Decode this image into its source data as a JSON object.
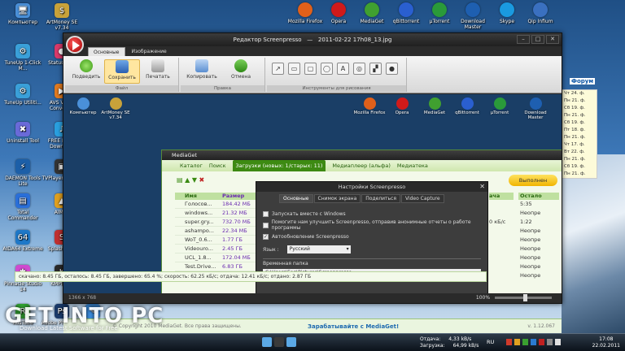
{
  "desktop": {
    "icons": [
      {
        "label": "Компьютер",
        "color": "#4a90d9",
        "glyph": "🖥"
      },
      {
        "label": "ArtMoney SE v7.34",
        "color": "#c8a23a",
        "glyph": "$"
      },
      {
        "label": "TuneUp 1-Click M...",
        "color": "#3aa0d9",
        "glyph": "⚙"
      },
      {
        "label": "StatusMa...",
        "color": "#d93a6a",
        "glyph": "●"
      },
      {
        "label": "TuneUp Utiliti...",
        "color": "#3aa0d9",
        "glyph": "⚙"
      },
      {
        "label": "AVS Video Converter",
        "color": "#e07a20",
        "glyph": "▶"
      },
      {
        "label": "Uninstall Tool",
        "color": "#6a6ad9",
        "glyph": "✖"
      },
      {
        "label": "FREE Music Download",
        "color": "#2aa0e0",
        "glyph": "♪"
      },
      {
        "label": "DAEMON Tools Lite",
        "color": "#1c5fa8",
        "glyph": "⚡"
      },
      {
        "label": "TVPlayer Classic",
        "color": "#333333",
        "glyph": "▣"
      },
      {
        "label": "Total Commander",
        "color": "#2a6fd9",
        "glyph": "▤"
      },
      {
        "label": "AIMP2",
        "color": "#e0a020",
        "glyph": "▲"
      },
      {
        "label": "AIDA64 Extreme",
        "color": "#1e78c8",
        "glyph": "64"
      },
      {
        "label": "Splash PRO",
        "color": "#c03030",
        "glyph": "S"
      },
      {
        "label": "Pinnacle Studio 14",
        "color": "#d04ad0",
        "glyph": "✱"
      },
      {
        "label": "KMPlayer",
        "color": "#2a2a2a",
        "glyph": "K"
      },
      {
        "label": "RusTube",
        "color": "#30a030",
        "glyph": "R"
      },
      {
        "label": "Adobe Photosh...",
        "color": "#1a3a6a",
        "glyph": "Ps"
      },
      {
        "label": "Paint",
        "color": "#3a8ad9",
        "glyph": "✎"
      }
    ],
    "top_icons": [
      {
        "label": "Mozilla Firefox",
        "color": "#e0601a"
      },
      {
        "label": "Opera",
        "color": "#d01a1a"
      },
      {
        "label": "MediaGet",
        "color": "#40a030"
      },
      {
        "label": "qBittorrent",
        "color": "#2a5fd0"
      },
      {
        "label": "µTorrent",
        "color": "#2a9a3a"
      },
      {
        "label": "Download Master",
        "color": "#1e5fb0"
      },
      {
        "label": "Skype",
        "color": "#1a9ae0"
      },
      {
        "label": "Qip Infium",
        "color": "#3a70c0"
      }
    ]
  },
  "editor": {
    "title": "Редактор Screenpresso",
    "filename": "2011-02-22 17h08_13.jpg",
    "tabs": [
      "Основные",
      "Изображение"
    ],
    "groups": {
      "file": {
        "label": "Файл",
        "buttons": [
          "Подведить",
          "Сохранить",
          "Печатать"
        ]
      },
      "edit": {
        "label": "Правка",
        "buttons": [
          "Копировать",
          "Отмена"
        ]
      },
      "draw": {
        "label": "Инструменты для рисования"
      }
    },
    "status_size": "1366 x 768",
    "zoom_label": "100%",
    "zoom_fraction": 0.5
  },
  "inner_icons": [
    {
      "label": "Компьютер",
      "color": "#4a90d9"
    },
    {
      "label": "ArtMoney SE v7.34",
      "color": "#c8a23a"
    },
    {
      "label": "Mozilla Firefox",
      "color": "#e0601a"
    },
    {
      "label": "Opera",
      "color": "#d01a1a"
    },
    {
      "label": "MediaGet",
      "color": "#40a030"
    },
    {
      "label": "qBittorrent",
      "color": "#2a5fd0"
    },
    {
      "label": "µTorrent",
      "color": "#2a9a3a"
    },
    {
      "label": "Download Master",
      "color": "#1e5fb0"
    }
  ],
  "mediaget": {
    "title": "MediaGet",
    "menu": [
      "Каталог",
      "Поиск",
      "Загрузки (новых: 1/старых: 11)",
      "Медиаплеер (альфа)",
      "Медиатека"
    ],
    "done_button": "Выполнен",
    "columns": {
      "name": "Имя",
      "size": "Размер",
      "speed": "ача",
      "remain": "Остало"
    },
    "rows": [
      {
        "name": "Голосов...",
        "size": "184.42 МБ",
        "speed": "",
        "remain": "5:35"
      },
      {
        "name": "windows...",
        "size": "21.32 МБ",
        "speed": "",
        "remain": "Неопре"
      },
      {
        "name": "super.gry...",
        "size": "732.70 МБ",
        "speed": "0 кБ/с",
        "remain": "1:22"
      },
      {
        "name": "ashampo...",
        "size": "22.34 МБ",
        "speed": "",
        "remain": "Неопре"
      },
      {
        "name": "WoT_0.6...",
        "size": "1.77 ГБ",
        "speed": "",
        "remain": "Неопре"
      },
      {
        "name": "Videouro...",
        "size": "2.45 ГБ",
        "speed": "",
        "remain": "Неопре"
      },
      {
        "name": "UCL_1.8...",
        "size": "172.04 МБ",
        "speed": "",
        "remain": "Неопре"
      },
      {
        "name": "Test.Drive...",
        "size": "6.83 ГБ",
        "speed": "",
        "remain": "Неопре"
      },
      {
        "name": "Screenpr...",
        "size": "6.04 МБ",
        "speed": "",
        "remain": "Неопре"
      }
    ],
    "statusline": "скачано: 8.45 ГБ, осталось: 8.45 ГБ, завершено: 65.4 %; скорость: 62.25 кБ/с; отдача: 12.41 кБ/с; отдано: 2.87 ГБ"
  },
  "settings": {
    "title": "Настройки Screenpresso",
    "tabs": [
      "Основные",
      "Снимок экрана",
      "Поделиться",
      "Video Capture"
    ],
    "options": [
      {
        "label": "Запускать вместе с Windows",
        "checked": ""
      },
      {
        "label": "Помогите нам улучшить Screenpresso, отправив анонимные отчеты о работе программы",
        "checked": ""
      },
      {
        "label": "Автообновление Screenpresso",
        "checked": "✓"
      }
    ],
    "lang_label": "Язык :",
    "lang_value": "Русский",
    "temp_label": "Временная папка",
    "temp_path": "C:\\Users\\Гоя\\Pictures\\Screenpresso"
  },
  "right_panel": {
    "forum": "Форум",
    "list": [
      "Чт 24. ф.",
      "Пн 21. ф.",
      "Сб 19. ф.",
      "Пн 21. ф.",
      "Сб 19. ф.",
      "Пт 18. ф.",
      "Пн 21. ф.",
      "Чт 17. ф.",
      "Вт 22. ф.",
      "Пн 21. ф.",
      "Сб 19. ф.",
      "Пн 21. ф."
    ]
  },
  "footer": {
    "copyright": "© Copyright 2010 MediaGet. Все права защищены.",
    "earn": "Зарабатывайте с MediaGet!",
    "version": "v. 1.12.067"
  },
  "taskbar": {
    "upload_label": "Отдача:",
    "upload_value": "4,33 kB/s",
    "download_label": "Загрузка:",
    "download_value": "64,99 kB/s",
    "lang": "RU",
    "time": "17:08",
    "date": "22.02.2011"
  },
  "watermark": {
    "text": "GET INTO PC",
    "sub": "Download Latest Software for Free"
  }
}
